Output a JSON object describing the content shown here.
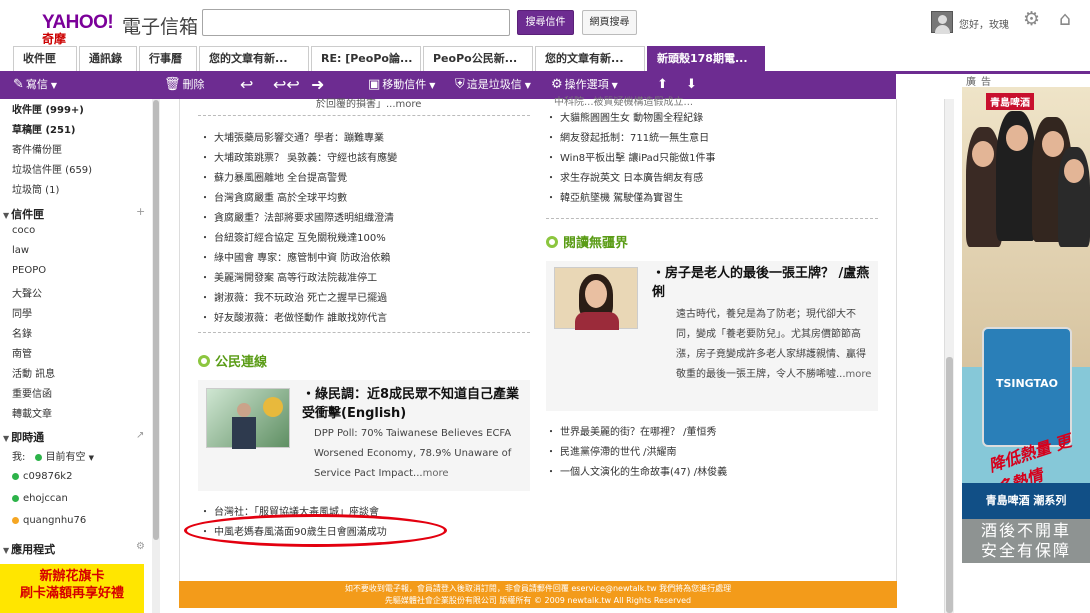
{
  "header": {
    "logo": "YAHOO!",
    "logo_sub": "奇摩",
    "mail_title": "電子信箱",
    "search_mail_button": "搜尋信件",
    "search_web_button": "網頁搜尋",
    "greeting": "您好，玫瑰"
  },
  "tabs": [
    "收件匣",
    "通訊錄",
    "行事曆",
    "您的文章有新...",
    "RE: [PeoPo論...",
    "PeoPo公民新...",
    "您的文章有新...",
    "新頭殼178期電..."
  ],
  "toolbar": {
    "compose": "寫信",
    "delete": "刪除",
    "move": "移動信件",
    "spam": "這是垃圾信",
    "actions": "操作選項"
  },
  "sidebar": {
    "folders": [
      {
        "label": "收件匣 (999+)",
        "bold": true
      },
      {
        "label": "草稿匣 (251)",
        "bold": true
      },
      {
        "label": "寄件備份匣",
        "bold": false
      },
      {
        "label": "垃圾信件匣 (659)",
        "bold": false
      },
      {
        "label": "垃圾筒 (1)",
        "bold": false
      }
    ],
    "my_folders_title": "信件匣",
    "my_folders": [
      "coco",
      "law",
      "PEOPO",
      "大聲公",
      "同學",
      "名錄",
      "南管",
      "活動 訊息",
      "重要信函",
      "轉載文章"
    ],
    "im_title": "即時通",
    "im_me": "我:",
    "im_status": "目前有空",
    "contacts": [
      {
        "name": "c09876k2",
        "color": "#2db34a"
      },
      {
        "name": "ehojccan",
        "color": "#2db34a"
      },
      {
        "name": "quangnhu76",
        "color": "#f5a623"
      }
    ],
    "apps_title": "應用程式",
    "promo_line1": "新辦花旗卡",
    "promo_line2": "刷卡滿額再享好禮"
  },
  "email": {
    "left_top_fragment": "於回覆的損害」...more",
    "left_links": [
      "大埔張藥局影響交通？學者：蹦難專業",
      "大埔政策跳票？ 吳敦義：守經也該有應變",
      "蘇力暴風圈離地 全台提高警覺",
      "台灣貪腐嚴重 高於全球平均數",
      "貪腐嚴重？法部將要求國際透明組織澄清",
      "台紐簽訂經合協定 互免關稅幾達100%",
      "綠中國會 專家：應管制中資 防政治依賴",
      "美麗灣開發案 高等行政法院裁准停工",
      "謝淑薇：我不玩政治 死亡之握早已擺過",
      "好友酸淑薇：老做怪動作 誰敢找妳代言"
    ],
    "section_citizen": "公民連線",
    "citizen_feature_title": "・綠民調：近8成民眾不知道自己產業受衝擊(English)",
    "citizen_feature_text": "DPP Poll: 70% Taiwanese Believes ECFA Worsened Economy, 78.9% Unaware of Service Pact Impact...",
    "citizen_feature_more": "more",
    "citizen_links": [
      "台灣社：「服貿協議大毒風城」座談會",
      "中風老媽春風滿面90歲生日會圓滿成功"
    ],
    "right_top_fragment": "中科院...被質疑機構造假成立...",
    "right_links": [
      "大貓熊圓圓生女 動物園全程紀錄",
      "網友發起抵制：711統一無生意日",
      "Win8平板出擊 讓iPad只能做1件事",
      "求生存說英文 日本廣告網友有感",
      "韓亞航墜機 駕駛僅為實習生"
    ],
    "section_talk": "閱讀無疆界",
    "talk_feature_title": "・房子是老人的最後一張王牌？ /盧燕俐",
    "talk_feature_text": "遠古時代，養兒是為了防老；現代卻大不同，變成「養老要防兒」。尤其房價節節高漲，房子竟變成許多老人家綁護親情、贏得敬重的最後一張王牌，令人不勝唏噓...",
    "talk_feature_more": "more",
    "talk_links": [
      "世界最美麗的街？在哪裡？ /董恒秀",
      "民進黨停滯的世代 /洪耀南",
      "一個人文演化的生命故事(47) /林俊義"
    ],
    "footer_line1": "如不要收到電子報，會員請登入後取消訂閱，非會員請郵件回覆 eservice@newtalk.tw 我們將為您進行處理",
    "footer_line2": "先驅媒體社會企業股份有限公司 版權所有 © 2009 newtalk.tw All Rights Reserved"
  },
  "ad": {
    "label": "廣告",
    "brand": "青島啤酒",
    "product": "TSINGTAO",
    "slogan": "降低熱量 更多熱情",
    "tagline": "青島啤酒 潮系列",
    "warning_line1": "酒後不開車",
    "warning_line2": "安全有保障"
  }
}
